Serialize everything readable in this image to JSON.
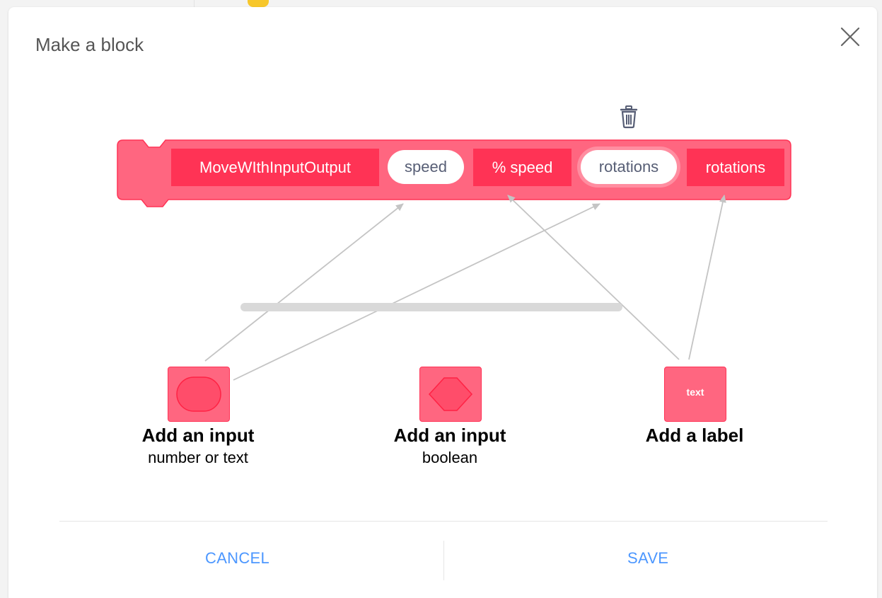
{
  "dialog": {
    "title": "Make a block",
    "close_icon": "close-icon"
  },
  "block": {
    "color": "#ff3355",
    "segments": [
      {
        "kind": "label",
        "text": "MoveWIthInputOutput"
      },
      {
        "kind": "input",
        "text": "speed"
      },
      {
        "kind": "label",
        "text": "% speed"
      },
      {
        "kind": "input",
        "text": "rotations",
        "selected": true
      },
      {
        "kind": "label",
        "text": "rotations"
      }
    ],
    "delete_icon": "trash-icon"
  },
  "options": [
    {
      "title": "Add an input",
      "subtitle": "number or text",
      "icon": "rounded-input-icon"
    },
    {
      "title": "Add an input",
      "subtitle": "boolean",
      "icon": "hexagon-input-icon"
    },
    {
      "title": "Add a label",
      "subtitle": "",
      "tile_text": "text",
      "icon": "text-label-icon"
    }
  ],
  "footer": {
    "cancel_label": "CANCEL",
    "save_label": "SAVE"
  },
  "colors": {
    "accent": "#4c97ff",
    "block": "#ff3355",
    "tile": "#ff6680"
  }
}
